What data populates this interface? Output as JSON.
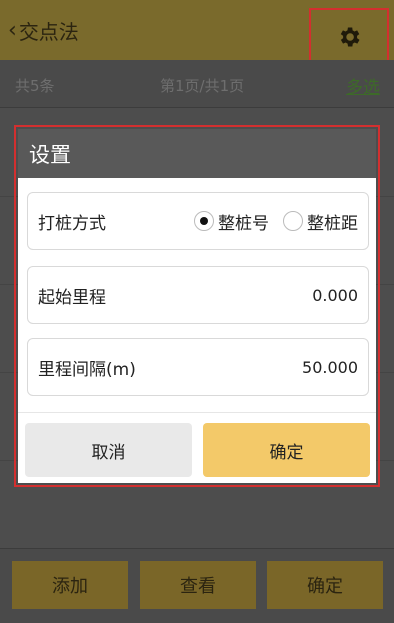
{
  "header": {
    "back_label": "交点法"
  },
  "list_header": {
    "count": "共5条",
    "page": "第1页/共1页",
    "multi_select": "多选"
  },
  "dialog": {
    "title": "设置",
    "pile_method": {
      "label": "打桩方式",
      "options": [
        "整桩号",
        "整桩距"
      ],
      "selected": "整桩号"
    },
    "start_mileage": {
      "label": "起始里程",
      "value": "0.000"
    },
    "mileage_interval": {
      "label": "里程间隔(m)",
      "value": "50.000"
    },
    "cancel_label": "取消",
    "confirm_label": "确定"
  },
  "footer": {
    "add_label": "添加",
    "view_label": "查看",
    "confirm_label": "确定"
  }
}
